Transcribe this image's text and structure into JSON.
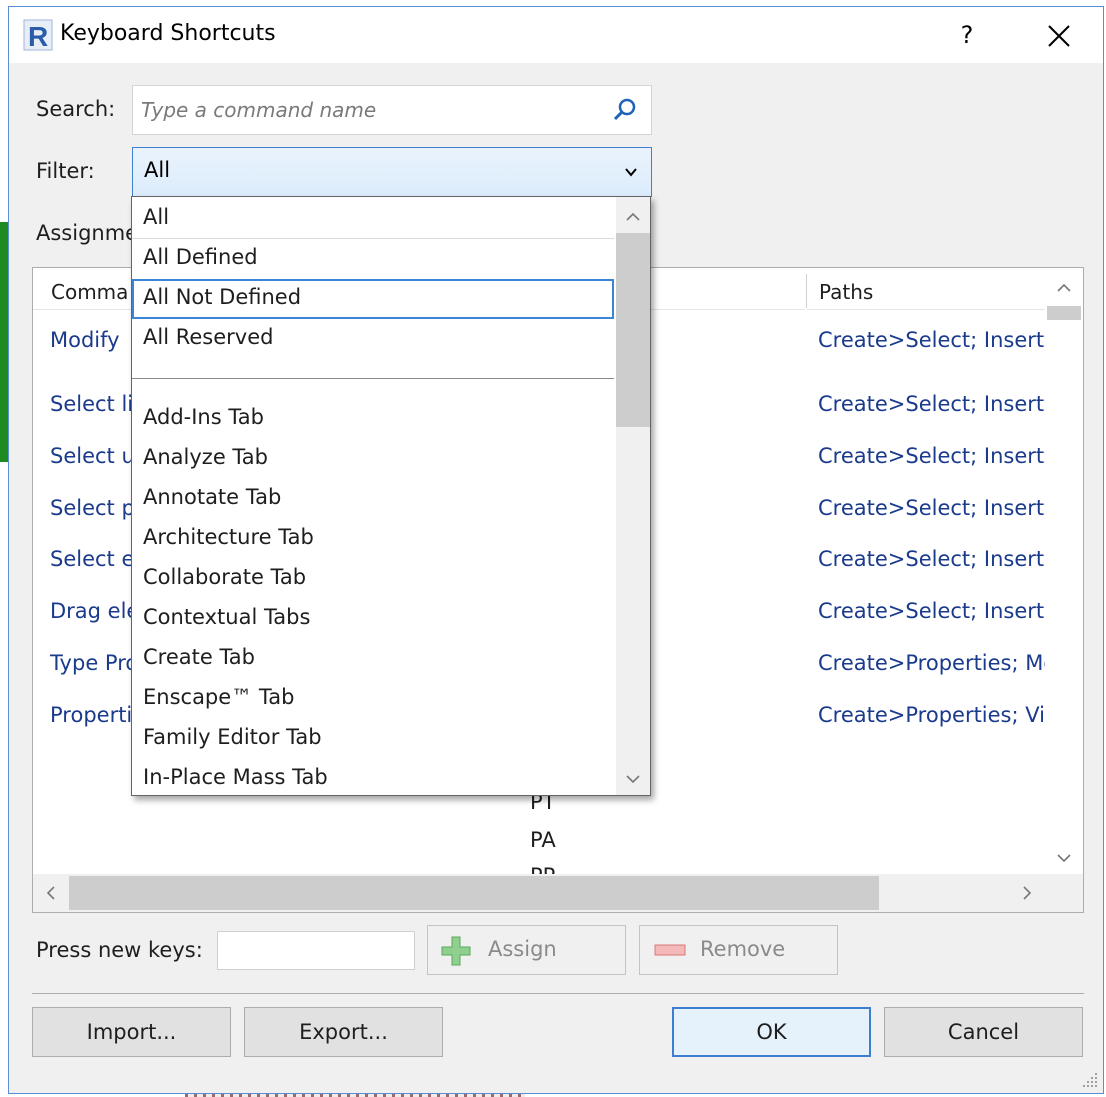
{
  "window": {
    "title": "Keyboard Shortcuts",
    "help_label": "?"
  },
  "search": {
    "label": "Search:",
    "placeholder": "Type a command name",
    "value": ""
  },
  "filter": {
    "label": "Filter:",
    "value": "All"
  },
  "assignments": {
    "label": "Assignme"
  },
  "grid": {
    "headers": {
      "commands": "Comma",
      "paths": "Paths"
    },
    "rows": [
      {
        "command": "Modify",
        "path": "Create>Select; Insert>"
      },
      {
        "command": "Select li",
        "path": "Create>Select; Insert>"
      },
      {
        "command": "Select u",
        "path": "Create>Select; Insert>"
      },
      {
        "command": "Select p",
        "path": "Create>Select; Insert>"
      },
      {
        "command": "Select e",
        "path": "Create>Select; Insert>"
      },
      {
        "command": "Drag ele",
        "path": "Create>Select; Insert>"
      },
      {
        "command": "Type Pro",
        "path": "Create>Properties; Mo"
      },
      {
        "command": "Properti",
        "path": "Create>Properties; Vie"
      }
    ],
    "visible_shortcuts": [
      "PT",
      "PA",
      "PP"
    ]
  },
  "dropdown": {
    "top_items": [
      "All",
      "All Defined",
      "All Not Defined",
      "All Reserved"
    ],
    "tab_items": [
      "Add-Ins Tab",
      "Analyze Tab",
      "Annotate Tab",
      "Architecture Tab",
      "Collaborate Tab",
      "Contextual Tabs",
      "Create Tab",
      "Enscape™ Tab",
      "Family Editor Tab",
      "In-Place Mass Tab"
    ],
    "selected": "All",
    "focused": "All Not Defined"
  },
  "keys": {
    "label": "Press new keys:",
    "value": ""
  },
  "buttons": {
    "assign": "Assign",
    "remove": "Remove",
    "import": "Import...",
    "export": "Export...",
    "ok": "OK",
    "cancel": "Cancel"
  },
  "icons": {
    "app": "revit-r-icon",
    "search": "magnifier-icon",
    "assign": "green-plus-icon",
    "remove": "red-minus-icon"
  },
  "colors": {
    "accent": "#3c80d2",
    "link_text": "#1a3a8c",
    "app_icon": "#2a5caa"
  }
}
